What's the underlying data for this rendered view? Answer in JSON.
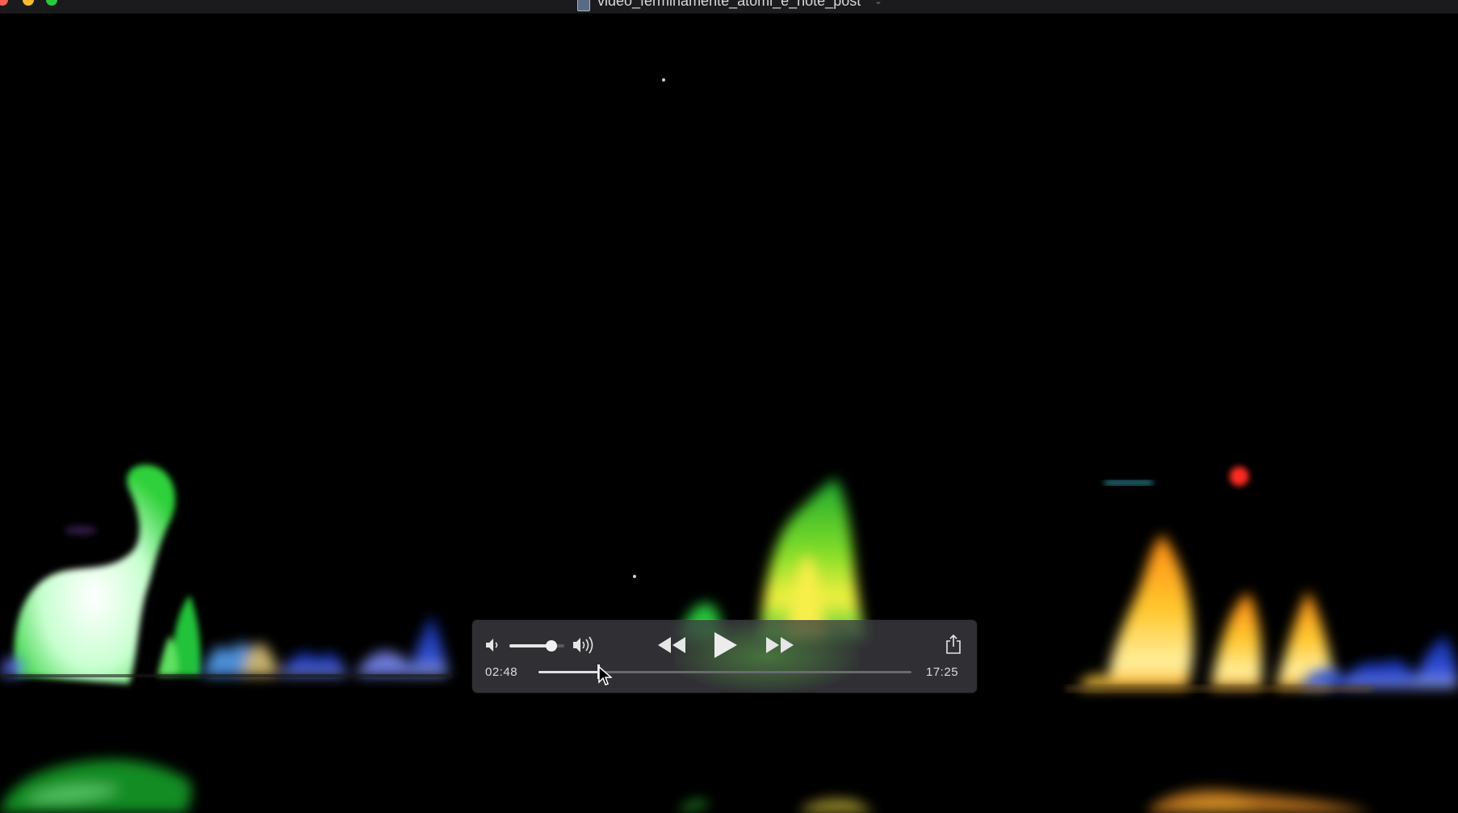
{
  "window": {
    "title": "video_ferminamente_atomi_e_note_post"
  },
  "player": {
    "current_time": "02:48",
    "total_time": "17:25",
    "progress_fraction": 0.161,
    "volume_fraction": 0.77,
    "state": "paused"
  },
  "icons": {
    "volume_low": "speaker-low-icon",
    "volume_high": "speaker-high-icon",
    "rewind": "rewind-icon",
    "play": "play-icon",
    "fast_forward": "fast-forward-icon",
    "share": "share-icon"
  },
  "colors": {
    "hud_background": "#3e3e42",
    "control_foreground": "#e6e6e6",
    "title_bar": "#1b1b1d"
  }
}
